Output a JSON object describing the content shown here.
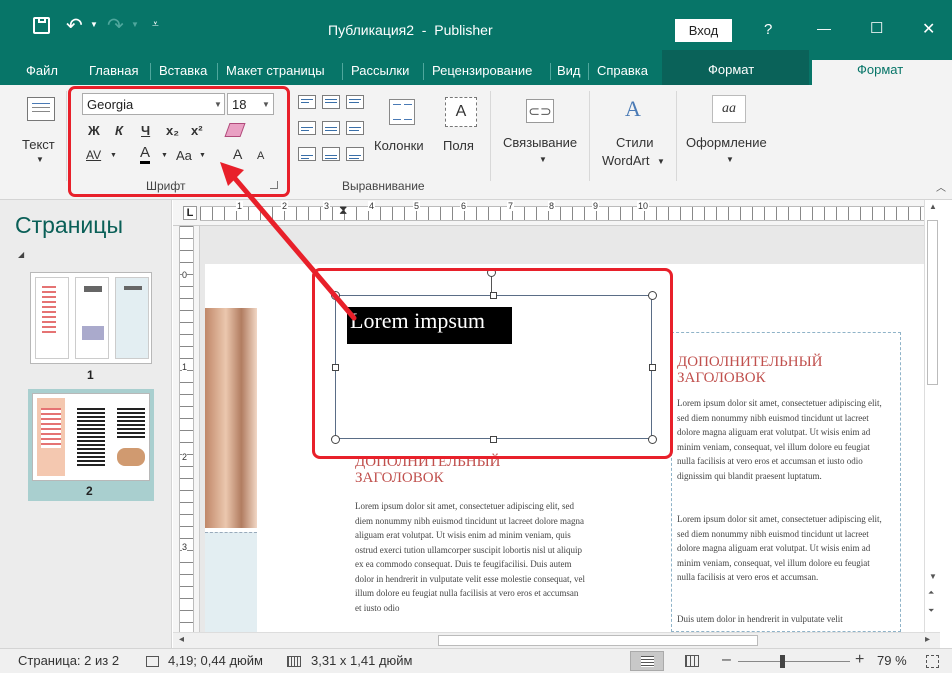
{
  "titlebar": {
    "title": "Публикация2  -  Publisher",
    "signin_label": "Вход",
    "help_label": "?",
    "minimize_glyph": "—",
    "maximize_glyph": "☐",
    "close_glyph": "✕"
  },
  "menu": {
    "file": "Файл",
    "home": "Главная",
    "insert": "Вставка",
    "layout": "Макет страницы",
    "mailings": "Рассылки",
    "review": "Рецензирование",
    "view": "Вид",
    "help": "Справка",
    "format_context": "Формат",
    "format_active": "Формат"
  },
  "ribbon": {
    "text_label": "Текст",
    "font_name": "Georgia",
    "font_size": "18",
    "bold": "Ж",
    "italic": "К",
    "underline": "Ч",
    "subscript": "x₂",
    "superscript": "x²",
    "spacing": "AV",
    "font_color": "A",
    "change_case": "Aa",
    "grow_font": "A",
    "shrink_font": "A",
    "font_group_label": "Шрифт",
    "columns_label": "Колонки",
    "margins_label": "Поля",
    "margins_icon_letter": "A",
    "align_group_label": "Выравнивание",
    "link_label": "Связывание",
    "wordart_label_1": "Стили",
    "wordart_label_2": "WordArt",
    "effects_label": "Оформление",
    "effects_icon_letter": "aa"
  },
  "pages_pane": {
    "title": "Страницы",
    "page1": "1",
    "page2": "2"
  },
  "ruler": {
    "h_numbers": [
      "1",
      "2",
      "3",
      "4",
      "5",
      "6",
      "7",
      "8",
      "9",
      "10"
    ],
    "v_numbers": [
      "0",
      "1",
      "2",
      "3"
    ]
  },
  "document": {
    "textbox_text": "Lorem impsum",
    "heading_middle": "ДОПОЛНИТЕЛЬНЫЙ ЗАГОЛОВОК",
    "heading_right": "ДОПОЛНИТЕЛЬНЫЙ ЗАГОЛОВОК",
    "middle_body": "Lorem ipsum dolor sit amet, consectetuer adipiscing elit, sed diem nonummy nibh euismod tincidunt ut lacreet dolore magna aliguam erat volutpat. Ut wisis enim ad minim veniam, quis ostrud exerci tution ullamcorper suscipit lobortis nisl ut aliquip ex ea commodo consequat. Duis te feugifacilisi. Duis autem dolor in hendrerit in vulputate velit esse molestie consequat, vel illum dolore eu feugiat nulla facilisis at vero eros et accumsan et iusto odio",
    "right_para_1": "Lorem ipsum dolor sit amet, consectetuer adipiscing elit, sed diem nonummy nibh euismod tincidunt ut lacreet dolore magna aliguam erat volutpat. Ut wisis enim ad minim veniam, consequat, vel illum dolore eu feugiat nulla facilisis at vero eros et accumsan et iusto odio dignissim qui blandit praesent luptatum.",
    "right_para_2": "Lorem ipsum dolor sit amet, consectetuer adipiscing elit, sed diem nonummy nibh euismod tincidunt ut lacreet dolore magna aliguam erat volutpat. Ut wisis enim ad minim veniam, consequat, vel illum dolore eu feugiat nulla facilisis at vero eros et accumsan.",
    "right_para_3": "Duis utem dolor in hendrerit in vulputate velit"
  },
  "statusbar": {
    "page": "Страница: 2 из 2",
    "position": "4,19; 0,44 дюйм",
    "size": "3,31 x 1,41 дюйм",
    "zoom": "79 %",
    "zoom_level": 0.79
  },
  "colors": {
    "accent": "#077568",
    "highlight": "#e8202a",
    "heading": "#c0504d"
  }
}
